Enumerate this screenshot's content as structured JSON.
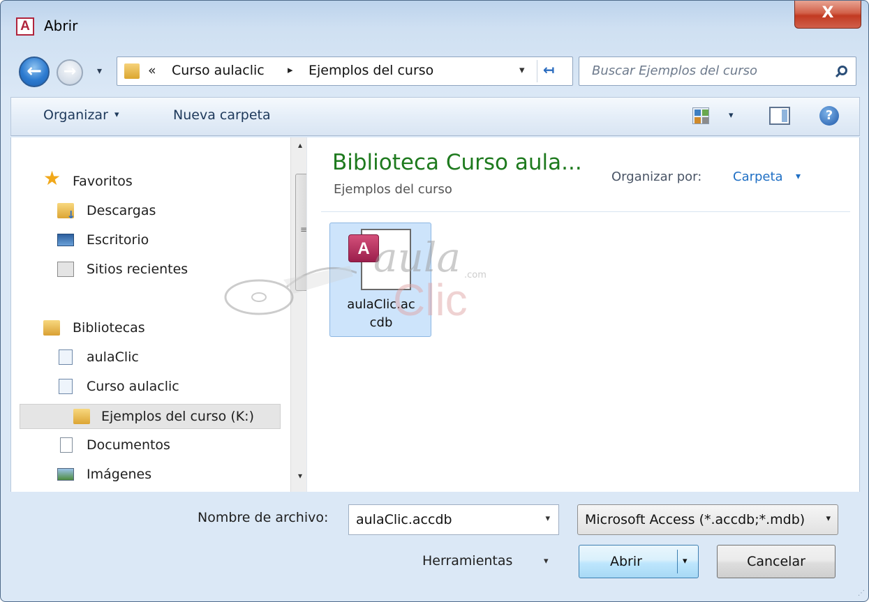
{
  "window": {
    "title": "Abrir",
    "app_icon_letter": "A",
    "close_glyph": "X"
  },
  "nav": {
    "back_glyph": "←",
    "forward_glyph": "→",
    "recent_glyph": "▾",
    "address": {
      "chevron": "«",
      "segments": [
        "Curso aulaclic",
        "Ejemplos del curso"
      ],
      "separator": "▸",
      "dropdown_glyph": "▾",
      "refresh_glyph": "↤"
    },
    "search": {
      "placeholder": "Buscar Ejemplos del curso"
    }
  },
  "toolbar": {
    "organize_label": "Organizar",
    "organize_arrow": "▾",
    "new_folder_label": "Nueva carpeta",
    "view_arrow": "▾",
    "help_glyph": "?"
  },
  "sidebar": {
    "items": [
      {
        "label": "Favoritos",
        "icon": "star-icon"
      },
      {
        "label": "Descargas",
        "icon": "download-folder-icon"
      },
      {
        "label": "Escritorio",
        "icon": "desktop-icon"
      },
      {
        "label": "Sitios recientes",
        "icon": "recent-places-icon"
      },
      {
        "label": "Bibliotecas",
        "icon": "libraries-icon"
      },
      {
        "label": "aulaClic",
        "icon": "library-icon"
      },
      {
        "label": "Curso aulaclic",
        "icon": "library-icon"
      },
      {
        "label": "Ejemplos del curso (K:)",
        "icon": "folder-icon",
        "selected": true
      },
      {
        "label": "Documentos",
        "icon": "documents-icon"
      },
      {
        "label": "Imágenes",
        "icon": "pictures-icon"
      }
    ],
    "scroll_up": "▴",
    "scroll_down": "▾",
    "scroll_grip": "≡",
    "star_glyph": "★"
  },
  "main": {
    "library_title": "Biblioteca Curso aula...",
    "library_subtitle": "Ejemplos del curso",
    "arrange_label": "Organizar por:",
    "arrange_value": "Carpeta",
    "arrange_arrow": "▾",
    "files": [
      {
        "name": "aulaClic.accdb",
        "name_line1": "aulaClic.ac",
        "name_line2": "cdb",
        "badge": "A",
        "selected": true
      }
    ],
    "watermark": {
      "line1": "aula",
      "line2": "Clic",
      "suffix": ".com"
    }
  },
  "footer": {
    "filename_label": "Nombre de archivo:",
    "filename_value": "aulaClic.accdb",
    "filetype_value": "Microsoft Access (*.accdb;*.mdb)",
    "tools_label": "Herramientas",
    "open_label": "Abrir",
    "cancel_label": "Cancelar",
    "dropdown_glyph": "▾",
    "grip": "⋰"
  },
  "colors": {
    "library_title": "#1e7a1e",
    "link_blue": "#1f6fc4",
    "close_red": "#c23a22",
    "selection_blue": "#cde4fb"
  }
}
